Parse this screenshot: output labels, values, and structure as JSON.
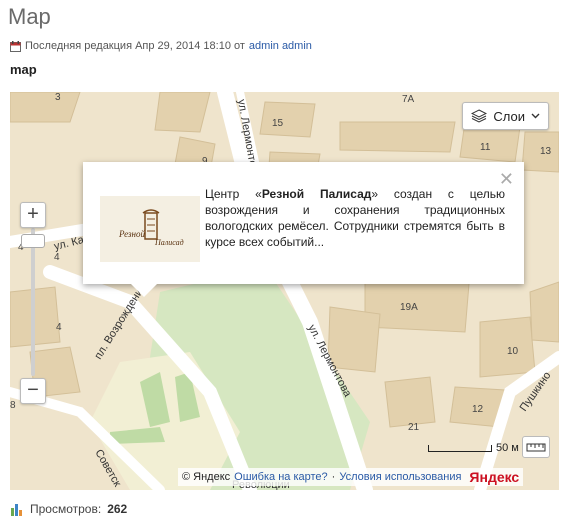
{
  "page": {
    "title": "Map",
    "meta_prefix": "Последняя редакция Апр 29, 2014 18:10 от",
    "author": "admin admin",
    "subheading": "map"
  },
  "map": {
    "layers_label": "Слои",
    "zoom_in": "+",
    "zoom_out": "−",
    "balloon": {
      "text_prefix": "Центр «",
      "text_bold": "Резной Палисад",
      "text_rest": "» создан с целью возрождения и сохранения традиционных вологодских ремёсел. Сотрудники стремятся быть в курсе всех событий...",
      "logo_text": "Резной Палисад"
    },
    "streets": [
      "ул. Лермонтова",
      "ул. Лермонтова",
      "пл. Возрождения",
      "ул. Кам",
      "Советск",
      "Пушкино",
      "Революции"
    ],
    "house_numbers": [
      "3",
      "7А",
      "15",
      "11",
      "13",
      "9",
      "4",
      "4",
      "19А",
      "10",
      "8",
      "21",
      "12",
      "4"
    ],
    "scale_label": "50 м",
    "copyright": {
      "yandex": "© Яндекс",
      "error_link": "Ошибка на карте?",
      "separator": "·",
      "terms_link": "Условия использования",
      "logo": "Яндекс"
    }
  },
  "footer": {
    "views_label": "Просмотров:",
    "views_count": "262"
  }
}
